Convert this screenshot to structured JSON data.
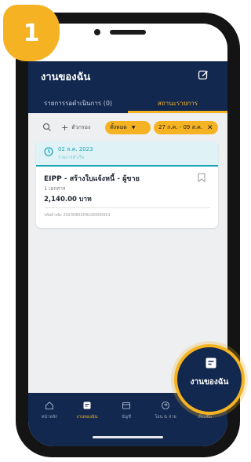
{
  "step": {
    "number": "1"
  },
  "header": {
    "title": "งานของฉัน",
    "tabs": [
      {
        "label": "รายการรอดำเนินการ (0)",
        "active": false
      },
      {
        "label": "สถานะรายการ",
        "active": true
      }
    ]
  },
  "filters": {
    "add_label": "ตัวกรอง",
    "all_chip": "ทั้งหมด",
    "date_chip": "27 ก.ค. - 09 ส.ค."
  },
  "card": {
    "date": "02 ส.ค. 2023",
    "status": "รายการสำเร็จ",
    "title": "EIPP - สร้างใบแจ้งหนี้ - ผู้ขาย",
    "docs": "1 เอกสาร",
    "amount": "2,140.00 บาท",
    "ref": "รหัสอ้างอิง 2023080209100000001"
  },
  "bottom_nav": {
    "items": [
      {
        "label": "หน้าหลัก",
        "icon": "home-icon"
      },
      {
        "label": "งานของฉัน",
        "icon": "my-work-icon",
        "active": true
      },
      {
        "label": "บัญชี",
        "icon": "account-icon"
      },
      {
        "label": "โอน & จ่าย",
        "icon": "transfer-icon"
      },
      {
        "label": "เพิ่มเติม",
        "icon": "more-icon"
      }
    ]
  },
  "highlight": {
    "label": "งานของฉัน"
  },
  "colors": {
    "navy": "#12284f",
    "accent": "#f5b323",
    "teal": "#1aa3b5"
  }
}
